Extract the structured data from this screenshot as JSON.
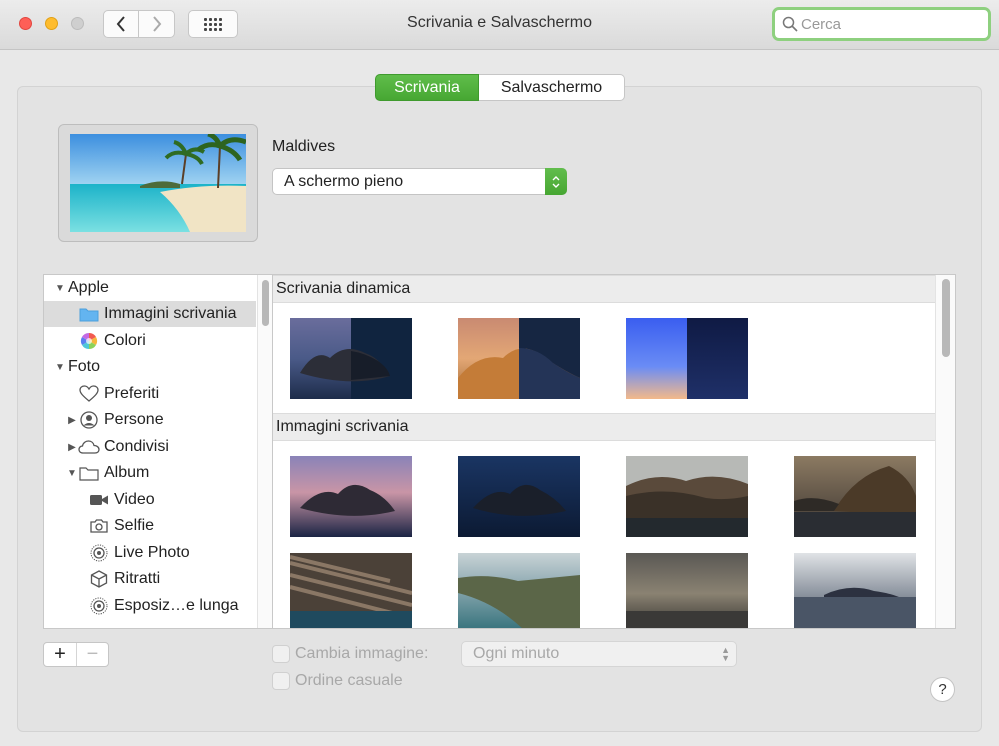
{
  "window": {
    "title": "Scrivania e Salvaschermo"
  },
  "search": {
    "placeholder": "Cerca"
  },
  "tabs": [
    {
      "label": "Scrivania",
      "active": true
    },
    {
      "label": "Salvaschermo",
      "active": false
    }
  ],
  "wallpaper": {
    "name": "Maldives",
    "fit_option": "A schermo pieno"
  },
  "sidebar": {
    "items": [
      {
        "label": "Apple",
        "expander": "open",
        "icon": ""
      },
      {
        "label": "Immagini scrivania",
        "expander": "",
        "icon": "folder-icon",
        "selected": true
      },
      {
        "label": "Colori",
        "expander": "",
        "icon": "color-wheel-icon"
      },
      {
        "label": "Foto",
        "expander": "open",
        "icon": ""
      },
      {
        "label": "Preferiti",
        "expander": "",
        "icon": "heart-icon"
      },
      {
        "label": "Persone",
        "expander": "closed",
        "icon": "person-icon"
      },
      {
        "label": "Condivisi",
        "expander": "closed",
        "icon": "cloud-icon"
      },
      {
        "label": "Album",
        "expander": "open",
        "icon": "folder-icon"
      },
      {
        "label": "Video",
        "expander": "",
        "icon": "video-camera-icon"
      },
      {
        "label": "Selfie",
        "expander": "",
        "icon": "selfie-camera-icon"
      },
      {
        "label": "Live Photo",
        "expander": "",
        "icon": "live-photo-icon"
      },
      {
        "label": "Ritratti",
        "expander": "",
        "icon": "cube-icon"
      },
      {
        "label": "Esposiz…e lunga",
        "expander": "",
        "icon": "live-photo-icon"
      }
    ]
  },
  "sections": [
    {
      "title": "Scrivania dinamica",
      "thumbnails": [
        "catalina-dynamic",
        "mojave-dynamic",
        "solar-gradients-dynamic"
      ]
    },
    {
      "title": "Immagini scrivania",
      "thumbnails": [
        "catalina-day",
        "catalina-night",
        "catalina-rocks",
        "catalina-coast-rock",
        "catalina-cliff",
        "catalina-island",
        "catalina-sea-clouds",
        "catalina-evening"
      ]
    }
  ],
  "bottom": {
    "add": "+",
    "remove": "−",
    "change_image_label": "Cambia immagine:",
    "interval": "Ogni minuto",
    "random_label": "Ordine casuale",
    "help": "?"
  },
  "colors": {
    "accent_green": "#4fb23b",
    "search_ring": "#8ed07f"
  }
}
